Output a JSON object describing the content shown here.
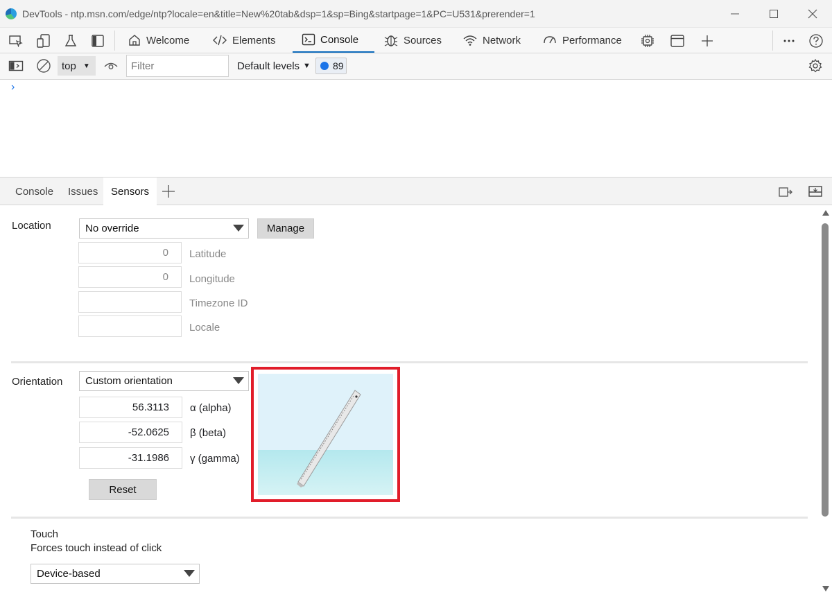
{
  "window": {
    "title": "DevTools - ntp.msn.com/edge/ntp?locale=en&title=New%20tab&dsp=1&sp=Bing&startpage=1&PC=U531&prerender=1"
  },
  "tool_tabs": {
    "welcome": "Welcome",
    "elements": "Elements",
    "console": "Console",
    "sources": "Sources",
    "network": "Network",
    "performance": "Performance"
  },
  "console_toolbar": {
    "context": "top",
    "filter_placeholder": "Filter",
    "levels": "Default levels",
    "message_count": "89"
  },
  "console": {
    "prompt": "›"
  },
  "drawer_tabs": {
    "console": "Console",
    "issues": "Issues",
    "sensors": "Sensors"
  },
  "sensors": {
    "location": {
      "label": "Location",
      "selected": "No override",
      "manage_label": "Manage",
      "latitude_value": "0",
      "latitude_label": "Latitude",
      "longitude_value": "0",
      "longitude_label": "Longitude",
      "timezone_value": "",
      "timezone_label": "Timezone ID",
      "locale_value": "",
      "locale_label": "Locale"
    },
    "orientation": {
      "label": "Orientation",
      "selected": "Custom orientation",
      "alpha_value": "56.3113",
      "alpha_label": "α (alpha)",
      "beta_value": "-52.0625",
      "beta_label": "β (beta)",
      "gamma_value": "-31.1986",
      "gamma_label": "γ (gamma)",
      "reset_label": "Reset"
    },
    "touch": {
      "title": "Touch",
      "description": "Forces touch instead of click",
      "selected": "Device-based"
    }
  },
  "colors": {
    "accent": "#0f6cbd",
    "highlight_border": "#e11d2a",
    "badge_dot": "#1a73e8"
  }
}
